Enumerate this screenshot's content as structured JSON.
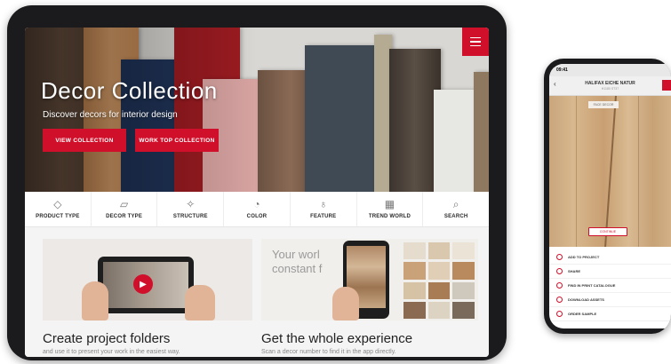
{
  "hero": {
    "title": "Decor Collection",
    "subtitle": "Discover decors for interior design",
    "btn_view": "VIEW COLLECTION",
    "btn_worktop": "WORK TOP COLLECTION"
  },
  "nav": [
    {
      "label": "PRODUCT TYPE",
      "icon": "layers-icon"
    },
    {
      "label": "DECOR TYPE",
      "icon": "panel-icon"
    },
    {
      "label": "STRUCTURE",
      "icon": "structure-icon"
    },
    {
      "label": "COLOR",
      "icon": "color-fan-icon"
    },
    {
      "label": "FEATURE",
      "icon": "feature-icon"
    },
    {
      "label": "TREND WORLD",
      "icon": "grid-icon"
    },
    {
      "label": "SEARCH",
      "icon": "search-icon"
    }
  ],
  "cards": [
    {
      "title": "Create project folders",
      "subtitle": "and use it to present your work in the easiest way."
    },
    {
      "title": "Get the whole experience",
      "subtitle": "Scan a decor number to find it in the app directly."
    }
  ],
  "card_overlay": {
    "line1": "Your worl",
    "line2": "constant f"
  },
  "phone": {
    "time": "09:41",
    "title": "HALIFAX EICHE NATUR",
    "subtitle": "H1180 ST37",
    "tag": "FACE DECOR",
    "cta": "CONTINUE",
    "items": [
      "ADD TO PROJECT",
      "SHARE",
      "FIND IN PRINT CATALOGUE",
      "DOWNLOAD ASSETS",
      "ORDER SAMPLE"
    ]
  },
  "colors": {
    "accent": "#d0102b"
  }
}
